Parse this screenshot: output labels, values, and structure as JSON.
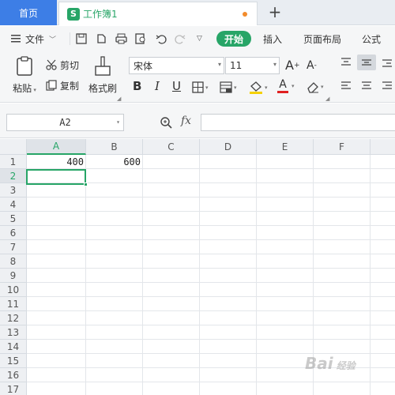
{
  "tabs": {
    "home_label": "首页",
    "doc_icon_letter": "S",
    "doc_name": "工作簿1",
    "new_tab": "+"
  },
  "menu": {
    "file_label": "文件",
    "start_label": "开始",
    "insert_label": "插入",
    "page_layout_label": "页面布局",
    "formula_label": "公式"
  },
  "ribbon": {
    "paste_label": "粘贴",
    "cut_label": "剪切",
    "copy_label": "复制",
    "format_painter_label": "格式刷",
    "font_name": "宋体",
    "font_size": "11",
    "grow_font": "A",
    "shrink_font": "A",
    "bold": "B",
    "italic": "I",
    "underline": "U",
    "font_color_letter": "A"
  },
  "formula_bar": {
    "name_box": "A2",
    "fx_label": "fx",
    "formula_value": ""
  },
  "sheet": {
    "columns": [
      "A",
      "B",
      "C",
      "D",
      "E",
      "F"
    ],
    "rows": [
      "1",
      "2",
      "3",
      "4",
      "5",
      "6",
      "7",
      "8",
      "9",
      "10",
      "11",
      "12",
      "13",
      "14",
      "15",
      "16",
      "17"
    ],
    "cells": {
      "A1": "400",
      "B1": "600"
    },
    "selected_cell": "A2"
  },
  "watermark": "Bai 经验"
}
